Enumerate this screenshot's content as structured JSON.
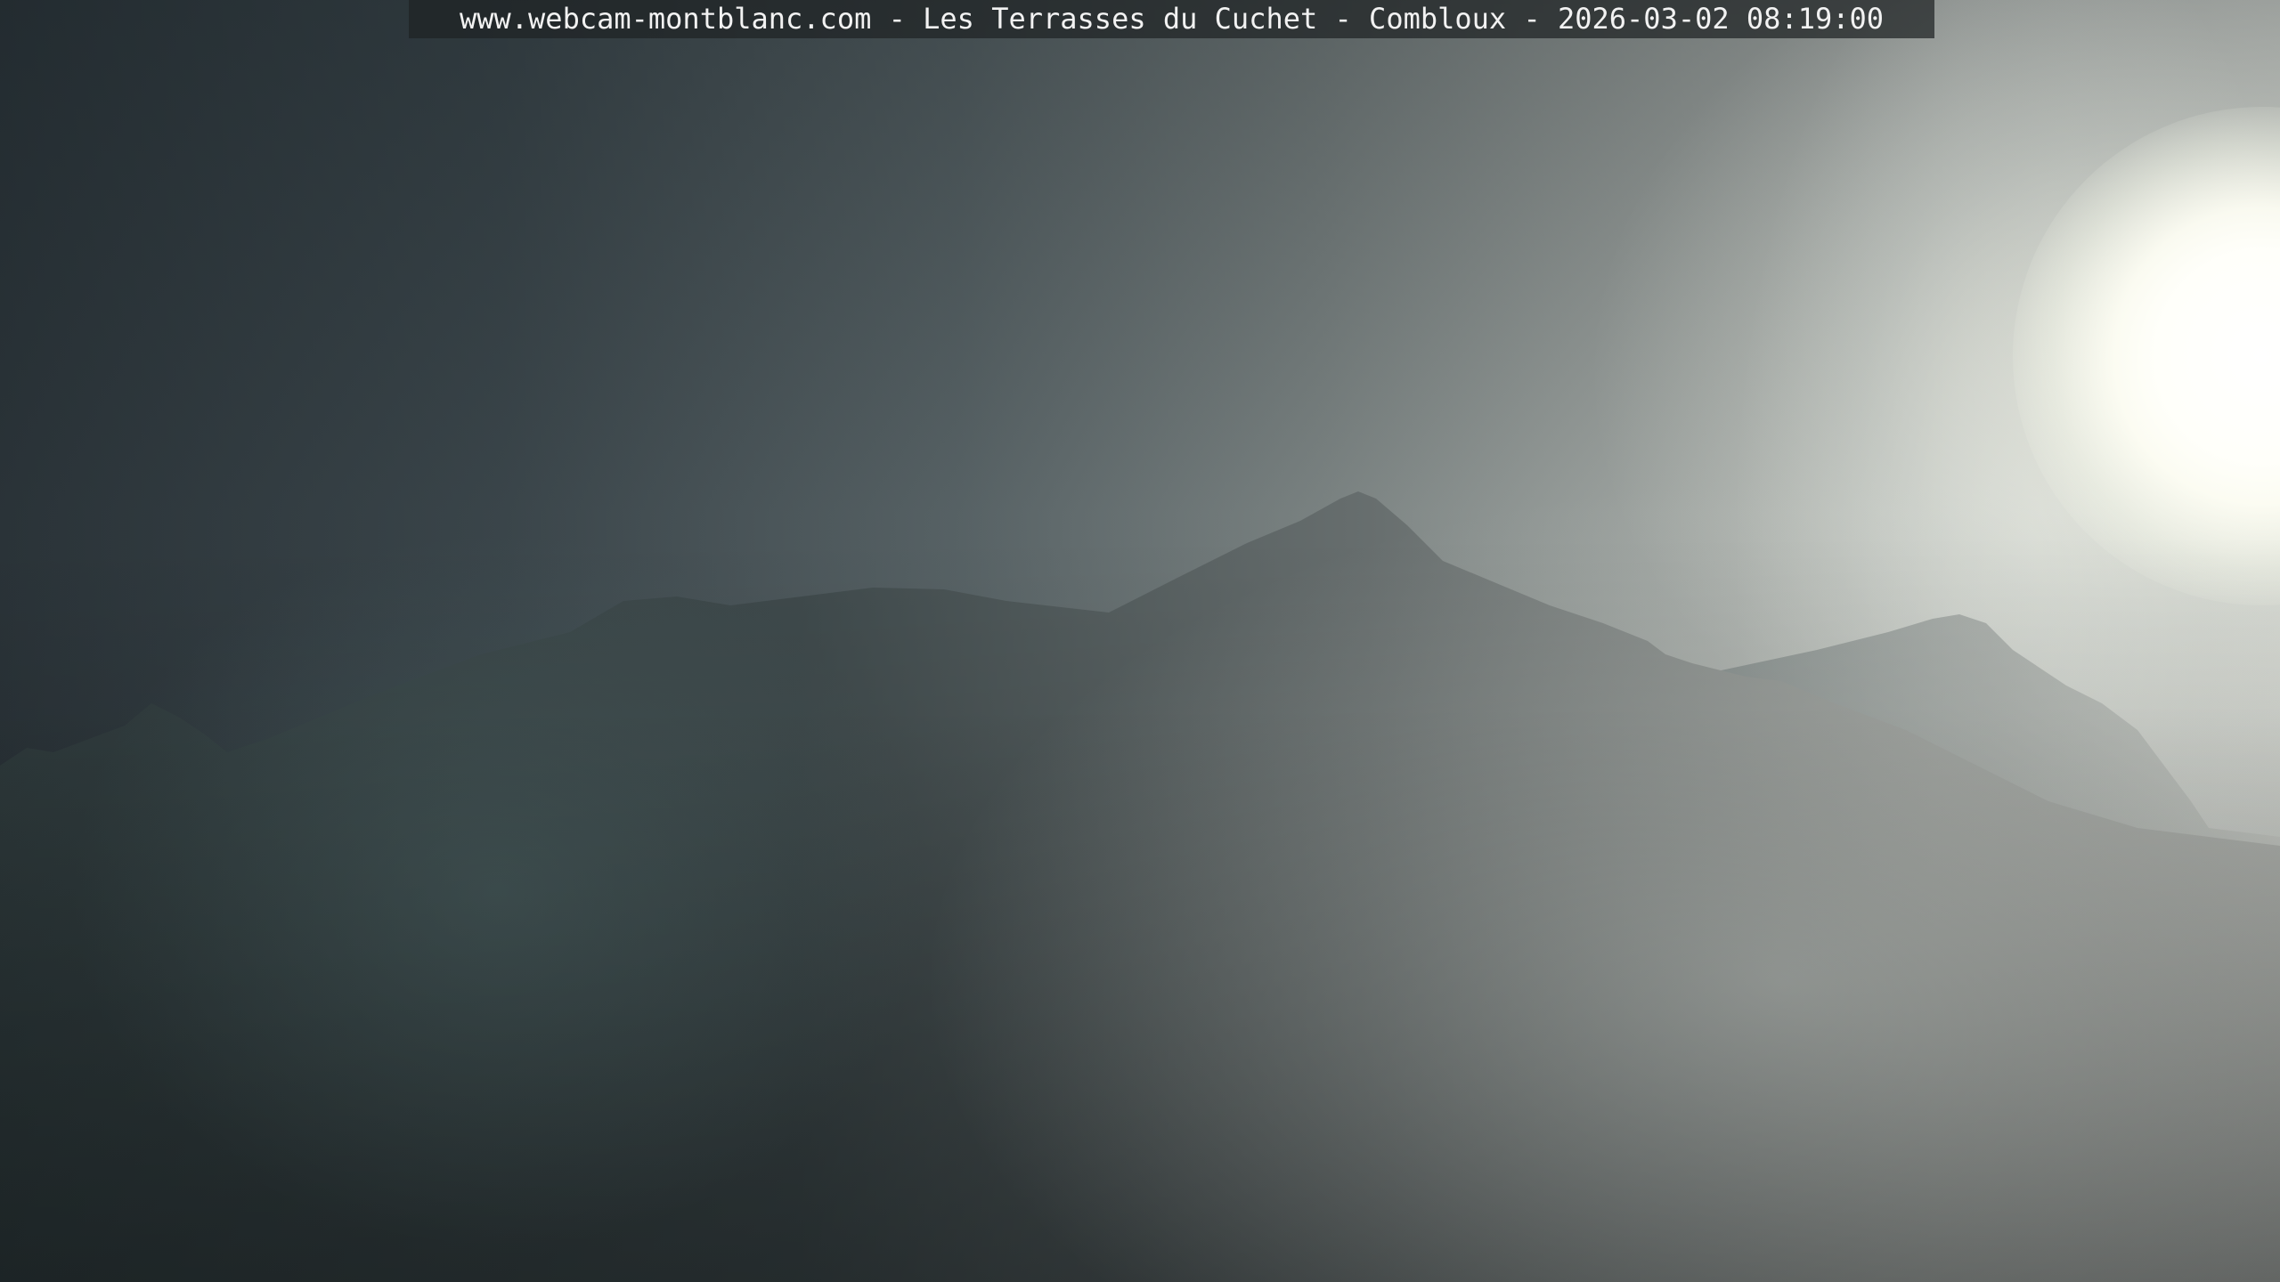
{
  "caption": {
    "text": "www.webcam-montblanc.com - Les Terrasses du Cuchet - Combloux - 2026-03-02 08:19:00"
  },
  "scene": {
    "sun_icon": "sun-icon",
    "colors": {
      "sky_dark": "#2b3439",
      "sky_light": "#d8dad4",
      "mountain_front": "#3a4346",
      "mountain_back": "#6f7676"
    }
  }
}
